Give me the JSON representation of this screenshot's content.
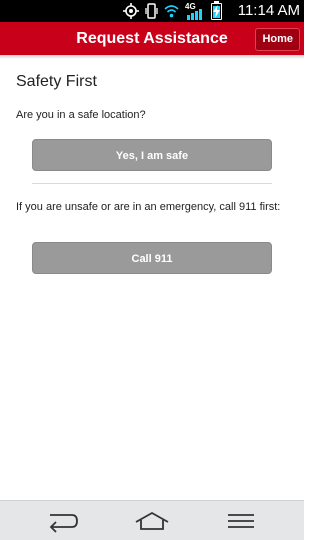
{
  "status_bar": {
    "network_label": "4G",
    "time": "11:14 AM",
    "battery_level": 0.85,
    "icons": [
      "gps-icon",
      "vibrate-icon",
      "wifi-icon",
      "lte-signal-icon",
      "battery-charging-icon"
    ]
  },
  "header": {
    "title": "Request Assistance",
    "home_label": "Home",
    "background_color": "#c8001a"
  },
  "content": {
    "heading": "Safety First",
    "question": "Are you in a safe location?",
    "safe_button_label": "Yes, I am safe",
    "emergency_text": "If you are unsafe or are in an emergency, call 911 first:",
    "call_button_label": "Call 911"
  },
  "navigation": {
    "icons": [
      "back-icon",
      "home-icon",
      "menu-icon"
    ]
  }
}
